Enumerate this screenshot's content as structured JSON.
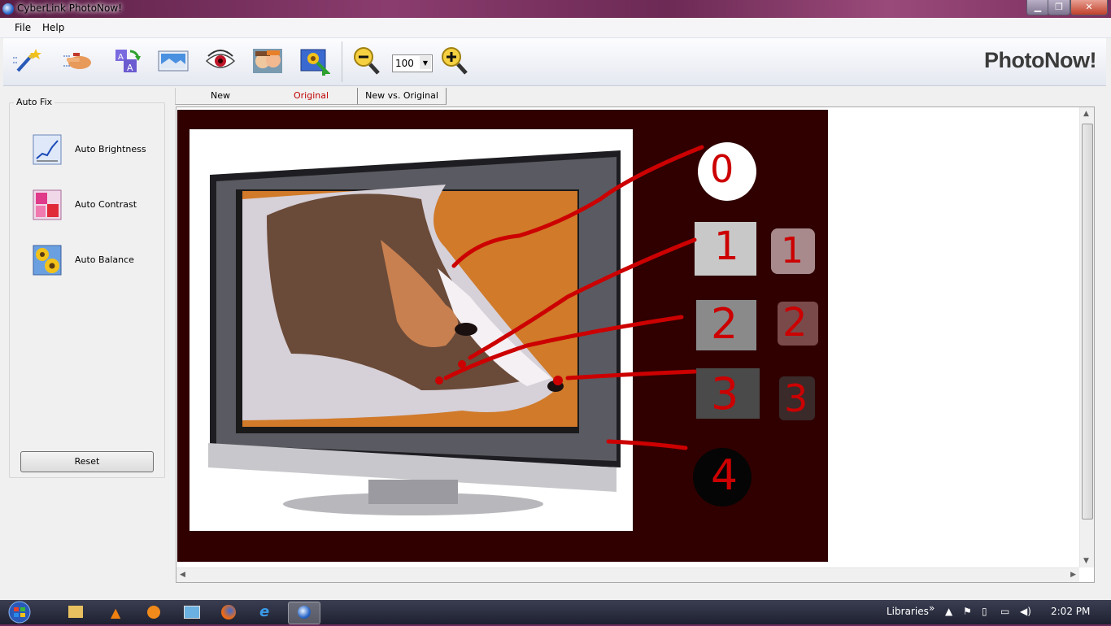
{
  "window": {
    "title": "CyberLink PhotoNow!"
  },
  "menu": {
    "file": "File",
    "help": "Help"
  },
  "toolbar": {
    "zoom_value": "100",
    "brand": "PhotoNow!",
    "tools": [
      {
        "icon": "magic-wand-icon"
      },
      {
        "icon": "hand-icon"
      },
      {
        "icon": "rotate-icon"
      },
      {
        "icon": "landscape-icon"
      },
      {
        "icon": "red-eye-icon"
      },
      {
        "icon": "faces-icon"
      },
      {
        "icon": "export-icon"
      }
    ]
  },
  "autofix": {
    "title": "Auto Fix",
    "brightness": "Auto Brightness",
    "contrast": "Auto Contrast",
    "balance": "Auto Balance",
    "reset": "Reset"
  },
  "tabs": {
    "new": "New",
    "original": "Original",
    "compare": "New vs. Original"
  },
  "image": {
    "labels": [
      "0",
      "1",
      "1",
      "2",
      "2",
      "3",
      "3",
      "4"
    ]
  },
  "taskbar": {
    "libraries": "Libraries",
    "time": "2:02 PM"
  },
  "colors": {
    "accent_red": "#cc0000",
    "image_bg": "#300000",
    "active_tab_text": "#c00000"
  }
}
